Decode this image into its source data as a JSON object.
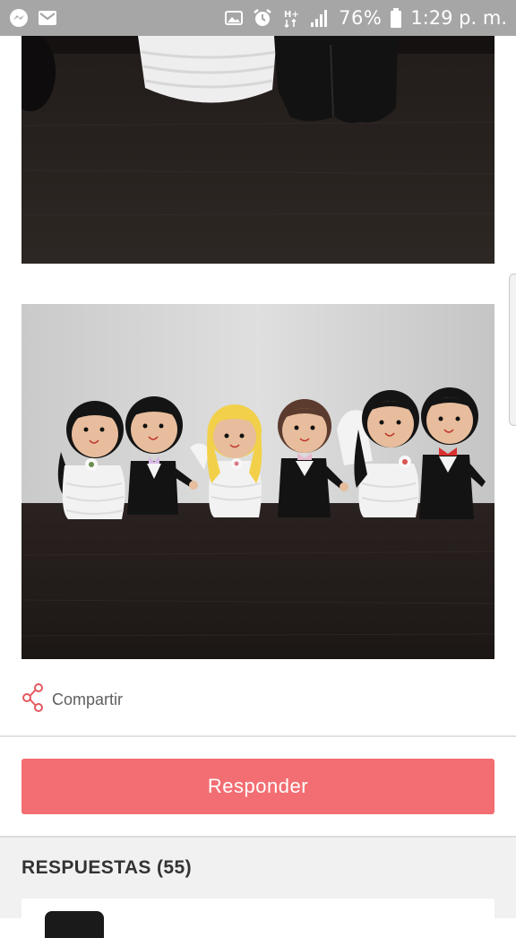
{
  "status_bar": {
    "battery_percent": "76%",
    "time": "1:29 p. m.",
    "icons": [
      "messenger-icon",
      "gmail-icon",
      "photo-icon",
      "alarm-icon",
      "hplus-data-icon",
      "signal-icon",
      "battery-icon"
    ]
  },
  "post": {
    "photos": [
      {
        "subject": "bottom of crochet bride and groom dolls on dark table"
      },
      {
        "subject": "six crochet wedding dolls (three couples) on dark table"
      }
    ],
    "share_label": "Compartir"
  },
  "actions": {
    "reply_label": "Responder"
  },
  "answers": {
    "title": "RESPUESTAS (55)"
  },
  "colors": {
    "status_bar_bg": "#a6a6a6",
    "accent": "#f36e72",
    "share_icon": "#e4595f"
  }
}
